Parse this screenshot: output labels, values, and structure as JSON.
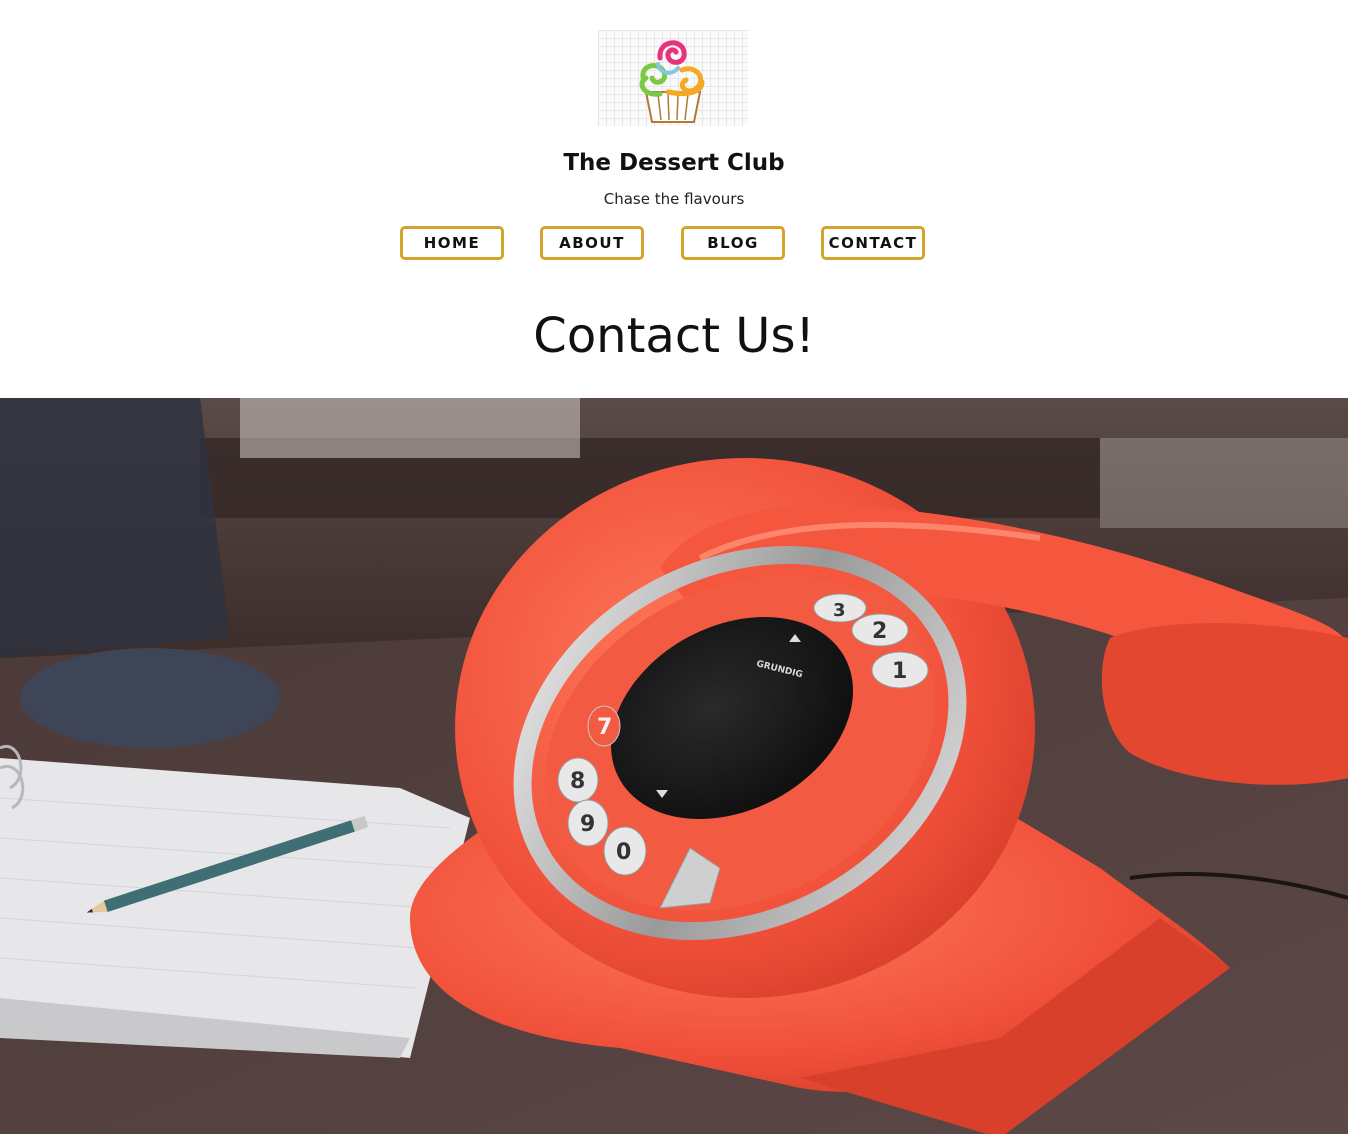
{
  "site": {
    "title": "The Dessert Club",
    "tagline": "Chase the flavours"
  },
  "nav": {
    "items": [
      {
        "label": "HOME"
      },
      {
        "label": "ABOUT"
      },
      {
        "label": "BLOG"
      },
      {
        "label": "CONTACT"
      }
    ]
  },
  "page": {
    "heading": "Contact Us!"
  },
  "hero": {
    "phone_brand": "GRUNDIG",
    "dial_digits": [
      "1",
      "2",
      "3",
      "7",
      "8",
      "9",
      "0"
    ]
  },
  "colors": {
    "nav_border": "#d4a32a",
    "phone": "#f0503a",
    "background": "#ffffff"
  }
}
